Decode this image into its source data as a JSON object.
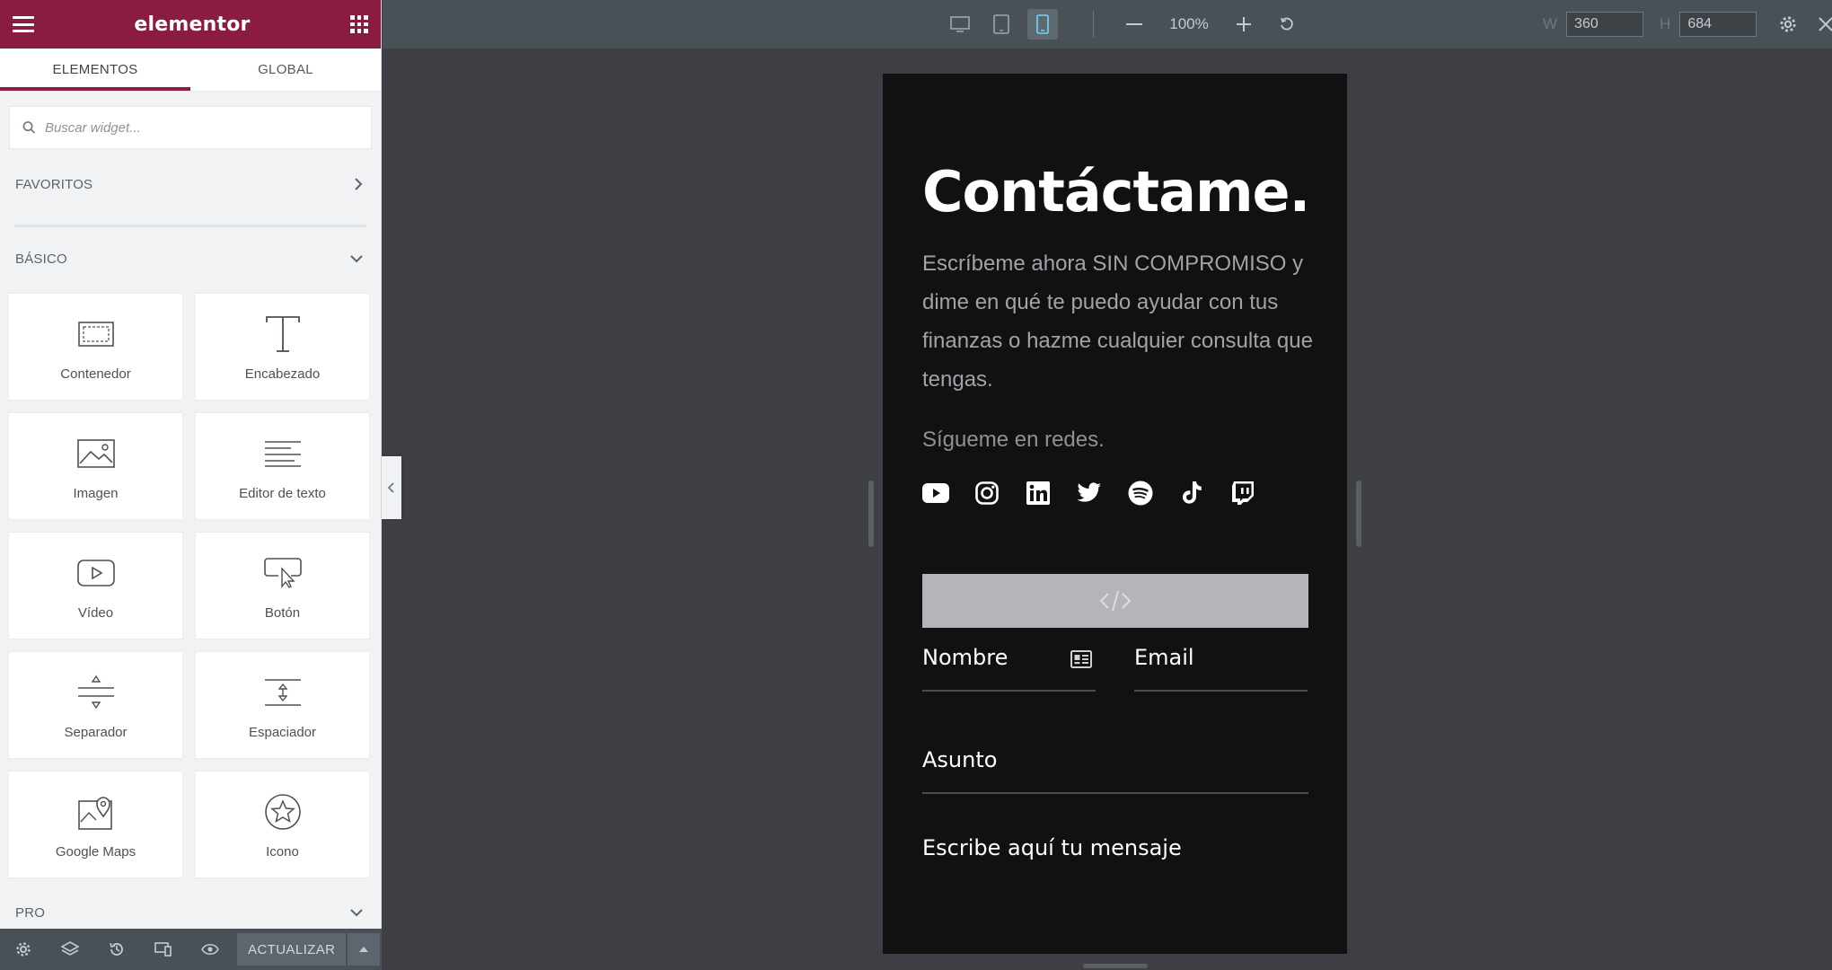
{
  "app": {
    "logo": "elementor"
  },
  "sidebar": {
    "tabs": [
      {
        "label": "ELEMENTOS",
        "active": true
      },
      {
        "label": "GLOBAL",
        "active": false
      }
    ],
    "search_placeholder": "Buscar widget...",
    "sections": {
      "favoritos": "FAVORITOS",
      "basico": "BÁSICO",
      "pro": "PRO"
    },
    "widgets": [
      {
        "label": "Contenedor",
        "icon": "container-icon"
      },
      {
        "label": "Encabezado",
        "icon": "heading-icon"
      },
      {
        "label": "Imagen",
        "icon": "image-icon"
      },
      {
        "label": "Editor de texto",
        "icon": "text-editor-icon"
      },
      {
        "label": "Vídeo",
        "icon": "video-icon"
      },
      {
        "label": "Botón",
        "icon": "button-icon"
      },
      {
        "label": "Separador",
        "icon": "divider-icon"
      },
      {
        "label": "Espaciador",
        "icon": "spacer-icon"
      },
      {
        "label": "Google Maps",
        "icon": "map-icon"
      },
      {
        "label": "Icono",
        "icon": "star-icon"
      }
    ],
    "footer": {
      "update_label": "ACTUALIZAR"
    }
  },
  "topbar": {
    "zoom": "100%",
    "width_label": "W",
    "width_value": "360",
    "height_label": "H",
    "height_value": "684",
    "active_device": "mobile"
  },
  "preview": {
    "title": "Contáctame.",
    "text": "Escríbeme ahora SIN COMPROMISO y dime en qué te puedo ayudar con tus finanzas o hazme cualquier consulta que tengas.",
    "follow": "Sígueme en redes.",
    "social": [
      "youtube-icon",
      "instagram-icon",
      "linkedin-icon",
      "twitter-icon",
      "spotify-icon",
      "tiktok-icon",
      "twitch-icon"
    ],
    "form": {
      "name_label": "Nombre",
      "email_label": "Email",
      "subject_label": "Asunto",
      "message_label": "Escribe aquí tu mensaje"
    }
  },
  "colors": {
    "brand": "#8a1d3f",
    "topbar": "#495157",
    "canvas": "#3d3f44",
    "preview_bg": "#111111"
  }
}
